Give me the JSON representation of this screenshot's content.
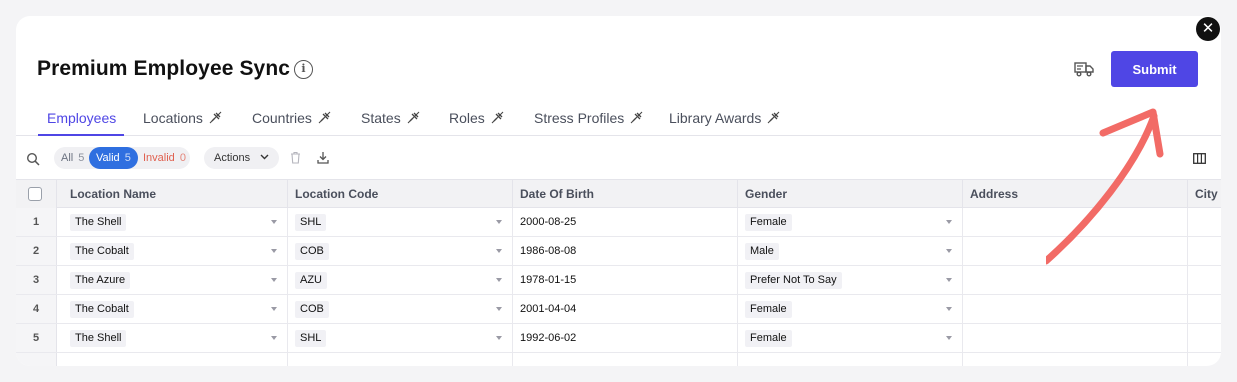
{
  "header": {
    "title": "Premium Employee Sync",
    "submit_label": "Submit"
  },
  "tabs": [
    {
      "label": "Employees",
      "active": true,
      "pinned": false
    },
    {
      "label": "Locations",
      "active": false,
      "pinned": true
    },
    {
      "label": "Countries",
      "active": false,
      "pinned": true
    },
    {
      "label": "States",
      "active": false,
      "pinned": true
    },
    {
      "label": "Roles",
      "active": false,
      "pinned": true
    },
    {
      "label": "Stress Profiles",
      "active": false,
      "pinned": true
    },
    {
      "label": "Library Awards",
      "active": false,
      "pinned": true
    }
  ],
  "toolbar": {
    "filters": {
      "all_label": "All",
      "all_count": "5",
      "valid_label": "Valid",
      "valid_count": "5",
      "invalid_label": "Invalid",
      "invalid_count": "0"
    },
    "actions_label": "Actions"
  },
  "table": {
    "columns": [
      "Location Name",
      "Location Code",
      "Date Of Birth",
      "Gender",
      "Address",
      "City"
    ],
    "rows": [
      {
        "num": "1",
        "location_name": "The Shell",
        "location_code": "SHL",
        "dob": "2000-08-25",
        "gender": "Female",
        "address": "",
        "city": ""
      },
      {
        "num": "2",
        "location_name": "The Cobalt",
        "location_code": "COB",
        "dob": "1986-08-08",
        "gender": "Male",
        "address": "",
        "city": ""
      },
      {
        "num": "3",
        "location_name": "The Azure",
        "location_code": "AZU",
        "dob": "1978-01-15",
        "gender": "Prefer Not To Say",
        "address": "",
        "city": ""
      },
      {
        "num": "4",
        "location_name": "The Cobalt",
        "location_code": "COB",
        "dob": "2001-04-04",
        "gender": "Female",
        "address": "",
        "city": ""
      },
      {
        "num": "5",
        "location_name": "The Shell",
        "location_code": "SHL",
        "dob": "1992-06-02",
        "gender": "Female",
        "address": "",
        "city": ""
      }
    ]
  },
  "icons": {
    "close": "close-icon",
    "info": "info-icon",
    "truck": "truck-icon",
    "search": "search-icon",
    "trash": "trash-icon",
    "download": "download-icon",
    "columns": "columns-icon",
    "pin": "pin-off-icon"
  },
  "colors": {
    "accent": "#4f46e5",
    "valid": "#2f6fe0",
    "invalid": "#e0604f",
    "annotation_arrow": "#f26b66"
  }
}
